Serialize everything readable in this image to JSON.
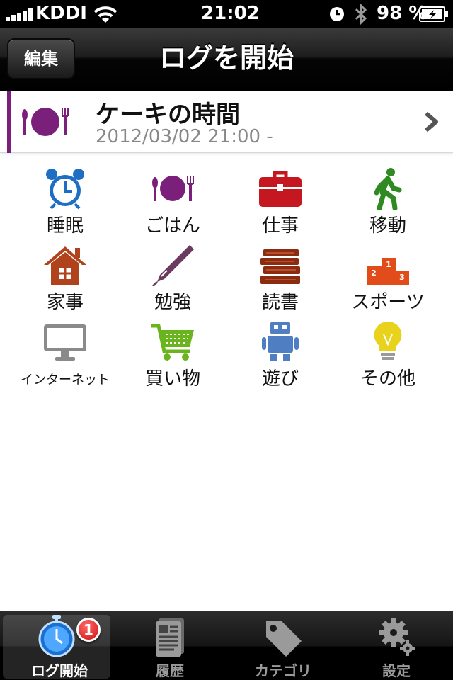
{
  "status": {
    "carrier": "KDDI",
    "time": "21:02",
    "battery": "98 %"
  },
  "nav": {
    "title": "ログを開始",
    "edit_label": "編集"
  },
  "current_log": {
    "title": "ケーキの時間",
    "time": "2012/03/02 21:00 -",
    "icon": "meal-icon",
    "accent_color": "#7a1f7a"
  },
  "categories": [
    {
      "label": "睡眠",
      "icon": "alarm-clock-icon",
      "color": "#1e6fc4"
    },
    {
      "label": "ごはん",
      "icon": "meal-icon",
      "color": "#7a1f7a"
    },
    {
      "label": "仕事",
      "icon": "briefcase-icon",
      "color": "#c4171f"
    },
    {
      "label": "移動",
      "icon": "walking-person-icon",
      "color": "#2f8a22"
    },
    {
      "label": "家事",
      "icon": "house-icon",
      "color": "#b0421c"
    },
    {
      "label": "勉強",
      "icon": "pen-icon",
      "color": "#6b3a5e"
    },
    {
      "label": "読書",
      "icon": "books-icon",
      "color": "#8b2b10"
    },
    {
      "label": "スポーツ",
      "icon": "podium-icon",
      "color": "#e24c1a"
    },
    {
      "label": "インターネット",
      "icon": "computer-icon",
      "color": "#8a8a8a"
    },
    {
      "label": "買い物",
      "icon": "shopping-cart-icon",
      "color": "#6ab41e"
    },
    {
      "label": "遊び",
      "icon": "robot-icon",
      "color": "#4f7fc2"
    },
    {
      "label": "その他",
      "icon": "lightbulb-icon",
      "color": "#e8d21c"
    }
  ],
  "tabs": [
    {
      "label": "ログ開始",
      "icon": "stopwatch-icon",
      "badge": "1",
      "active": true
    },
    {
      "label": "履歴",
      "icon": "document-icon"
    },
    {
      "label": "カテゴリ",
      "icon": "tag-icon"
    },
    {
      "label": "設定",
      "icon": "gear-icon"
    }
  ]
}
